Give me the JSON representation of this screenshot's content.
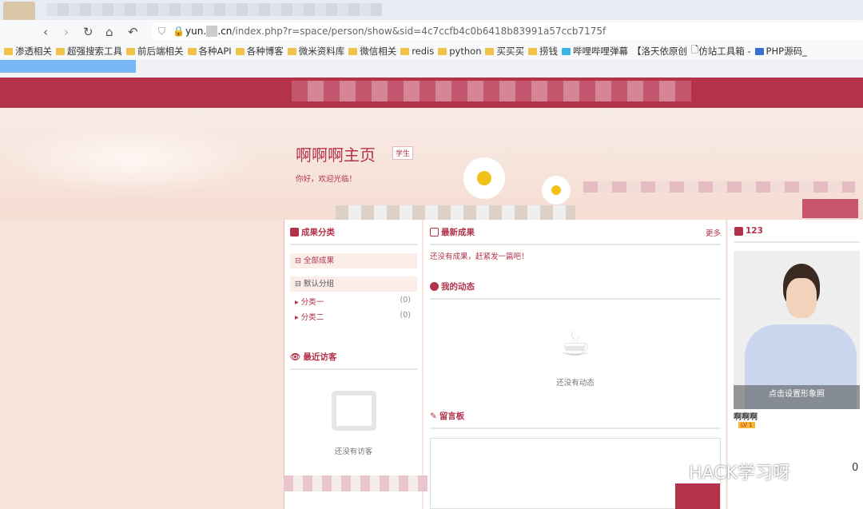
{
  "browser": {
    "url_host": "yun.",
    "url_host_tld": ".cn",
    "url_path": "/index.php?r=space/person/show&sid=4c7ccfb4c0b6418b83991a57ccb7175f",
    "bookmarks": [
      "渗透相关",
      "超强搜索工具",
      "前后端相关",
      "各种API",
      "各种博客",
      "微米资料库",
      "微信相关",
      "redis",
      "python",
      "买买买",
      "捞钱",
      "哔哩哔哩弹幕",
      "【洛天依原创",
      "仿站工具箱 -",
      "PHP源码_"
    ]
  },
  "header": {
    "title": "啊啊啊主页",
    "role_badge": "学生",
    "welcome": "你好，欢迎光临！"
  },
  "left": {
    "category_title": "成果分类",
    "all_label": "全部成果",
    "default_group": "默认分组",
    "subs": [
      {
        "label": "分类一",
        "count": "(0)"
      },
      {
        "label": "分类二",
        "count": "(0)"
      }
    ],
    "visitors_title": "最近访客",
    "visitors_empty": "还没有访客"
  },
  "middle": {
    "latest_title": "最新成果",
    "more": "更多",
    "latest_empty": "还没有成果，赶紧发一篇吧！",
    "activity_title": "我的动态",
    "activity_empty": "还没有动态",
    "board_title": "留言板"
  },
  "right": {
    "title": "123",
    "avatar_caption": "点击设置形象照",
    "name": "啊啊啊",
    "level": "LV 1",
    "stat": "0"
  },
  "watermark": "HACK学习呀"
}
